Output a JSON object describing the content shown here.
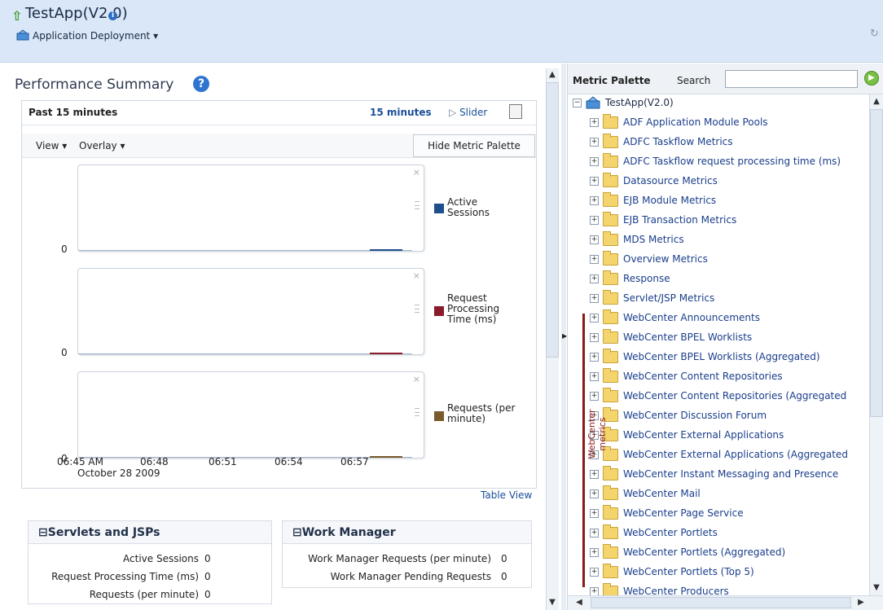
{
  "header": {
    "app_title": "TestApp(V2.0)",
    "deployment_label": "Application Deployment"
  },
  "summary": {
    "title": "Performance Summary",
    "past_label": "Past 15 minutes",
    "duration_link": "15 minutes",
    "slider_label": "Slider",
    "view_menu": "View",
    "overlay_menu": "Overlay",
    "hide_palette_button": "Hide Metric Palette",
    "table_view_link": "Table View"
  },
  "chart_data": {
    "type": "line",
    "x_tick_labels": [
      "06:45 AM",
      "06:48",
      "06:51",
      "06:54",
      "06:57"
    ],
    "x_date_label": "October 28 2009",
    "series": [
      {
        "name": "Active Sessions",
        "color": "#1f4e8c",
        "y_axis_label": "0"
      },
      {
        "name": "Request Processing Time (ms)",
        "color": "#8b1a2a",
        "y_axis_label": "0"
      },
      {
        "name": "Requests (per minute)",
        "color": "#7a5a2a",
        "y_axis_label": "0"
      }
    ]
  },
  "legends": {
    "active_sessions_1": "Active",
    "active_sessions_2": "Sessions",
    "request_time_1": "Request",
    "request_time_2": "Processing",
    "request_time_3": "Time (ms)",
    "requests_1": "Requests (per",
    "requests_2": "minute)"
  },
  "servlets": {
    "title": "Servlets and JSPs",
    "rows": [
      {
        "label": "Active Sessions",
        "value": "0"
      },
      {
        "label": "Request Processing Time (ms)",
        "value": "0"
      },
      {
        "label": "Requests (per minute)",
        "value": "0"
      }
    ]
  },
  "work_manager": {
    "title": "Work Manager",
    "rows": [
      {
        "label": "Work Manager Requests (per minute)",
        "value": "0"
      },
      {
        "label": "Work Manager Pending Requests",
        "value": "0"
      }
    ]
  },
  "palette": {
    "title": "Metric Palette",
    "search_label": "Search",
    "search_value": "",
    "root": "TestApp(V2.0)",
    "webcenter_label": "WebCenter metrics",
    "items": [
      "ADF Application Module Pools",
      "ADFC Taskflow Metrics",
      "ADFC Taskflow request processing time (ms)",
      "Datasource Metrics",
      "EJB Module Metrics",
      "EJB Transaction Metrics",
      "MDS Metrics",
      "Overview Metrics",
      "Response",
      "Servlet/JSP Metrics",
      "WebCenter Announcements",
      "WebCenter BPEL Worklists",
      "WebCenter BPEL Worklists (Aggregated)",
      "WebCenter Content Repositories",
      "WebCenter Content Repositories (Aggregated",
      "WebCenter Discussion Forum",
      "WebCenter External Applications",
      "WebCenter External Applications (Aggregated",
      "WebCenter Instant Messaging and Presence",
      "WebCenter Mail",
      "WebCenter Page Service",
      "WebCenter Portlets",
      "WebCenter Portlets (Aggregated)",
      "WebCenter Portlets (Top 5)",
      "WebCenter Producers"
    ]
  }
}
